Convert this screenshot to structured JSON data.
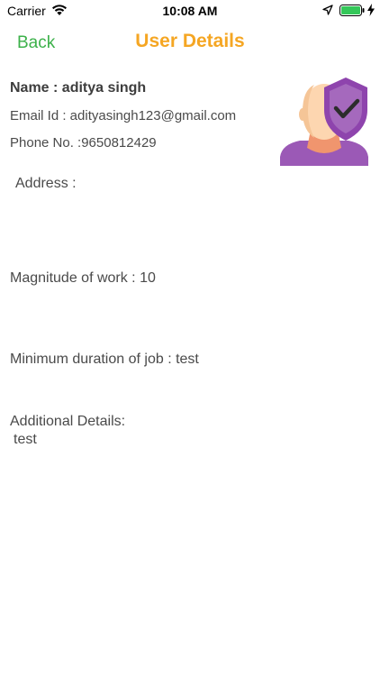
{
  "status_bar": {
    "carrier": "Carrier",
    "time": "10:08 AM",
    "battery_color": "#34c759"
  },
  "nav": {
    "back_label": "Back",
    "title": "User Details",
    "back_color": "#3cb14a",
    "title_color": "#f5a623"
  },
  "user": {
    "name": "Name : aditya singh",
    "email": "Email Id : adityasingh123@gmail.com",
    "phone": "Phone No. :9650812429",
    "avatar_icon": "user-shield-avatar"
  },
  "details": {
    "address": "Address :",
    "magnitude": "Magnitude of work : 10",
    "duration": "Minimum duration of job : test",
    "additional_label": "Additional Details:",
    "additional_value": "test"
  }
}
